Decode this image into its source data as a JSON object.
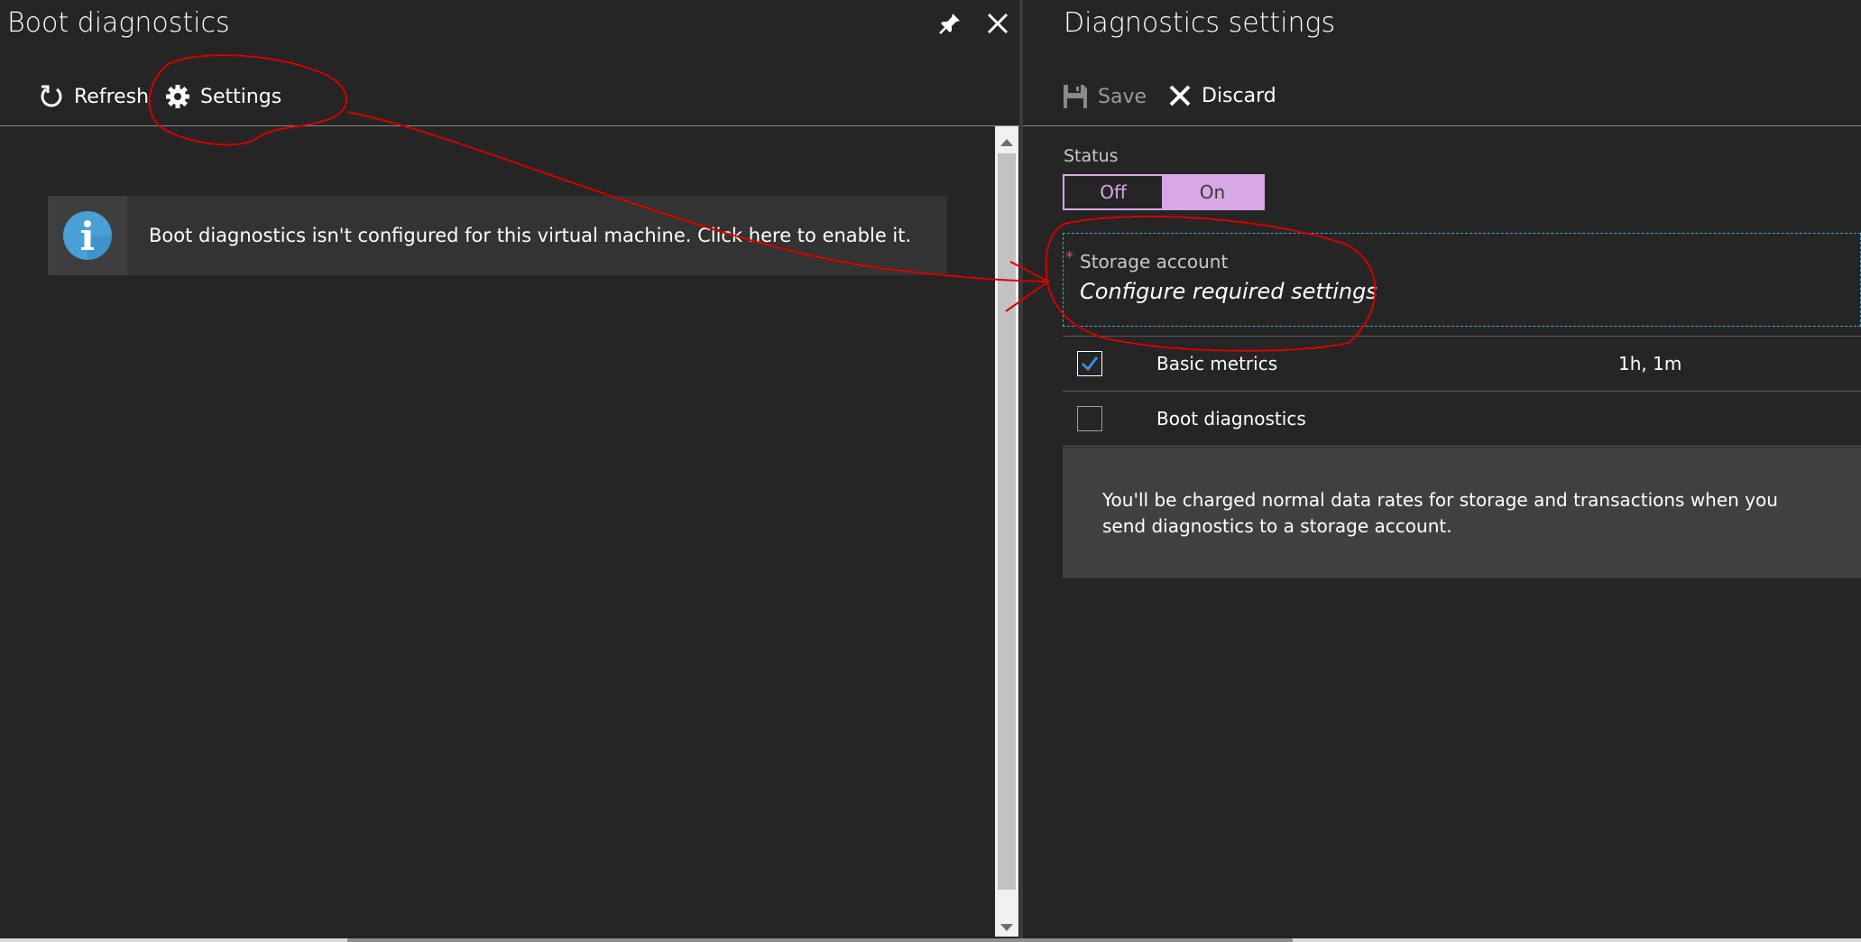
{
  "left_blade": {
    "title": "Boot diagnostics",
    "pin_icon": "pin-icon",
    "close_icon": "close-icon",
    "toolbar": {
      "refresh_label": "Refresh",
      "refresh_icon": "refresh-icon",
      "settings_label": "Settings",
      "settings_icon": "gear-icon"
    },
    "info_banner": {
      "icon": "info-icon",
      "text": "Boot diagnostics isn't configured for this virtual machine. Click here to enable it."
    }
  },
  "right_blade": {
    "title": "Diagnostics settings",
    "toolbar": {
      "save_label": "Save",
      "save_icon": "save-icon",
      "save_enabled": false,
      "discard_label": "Discard",
      "discard_icon": "close-icon"
    },
    "status": {
      "label": "Status",
      "off_label": "Off",
      "on_label": "On",
      "selected": "On"
    },
    "storage_account": {
      "required_marker": "*",
      "label": "Storage account",
      "value": "Configure required settings"
    },
    "options": [
      {
        "label": "Basic metrics",
        "value": "1h, 1m",
        "checked": true
      },
      {
        "label": "Boot diagnostics",
        "value": "",
        "checked": false
      }
    ],
    "note": "You'll be charged normal data rates for storage and transactions when you send diagnostics to a storage account."
  },
  "colors": {
    "background": "#252525",
    "accent_toggle": "#d8a7e6",
    "info_icon": "#4a9fd5",
    "checkmark": "#3b8fe0",
    "annotation": "#d40000"
  }
}
